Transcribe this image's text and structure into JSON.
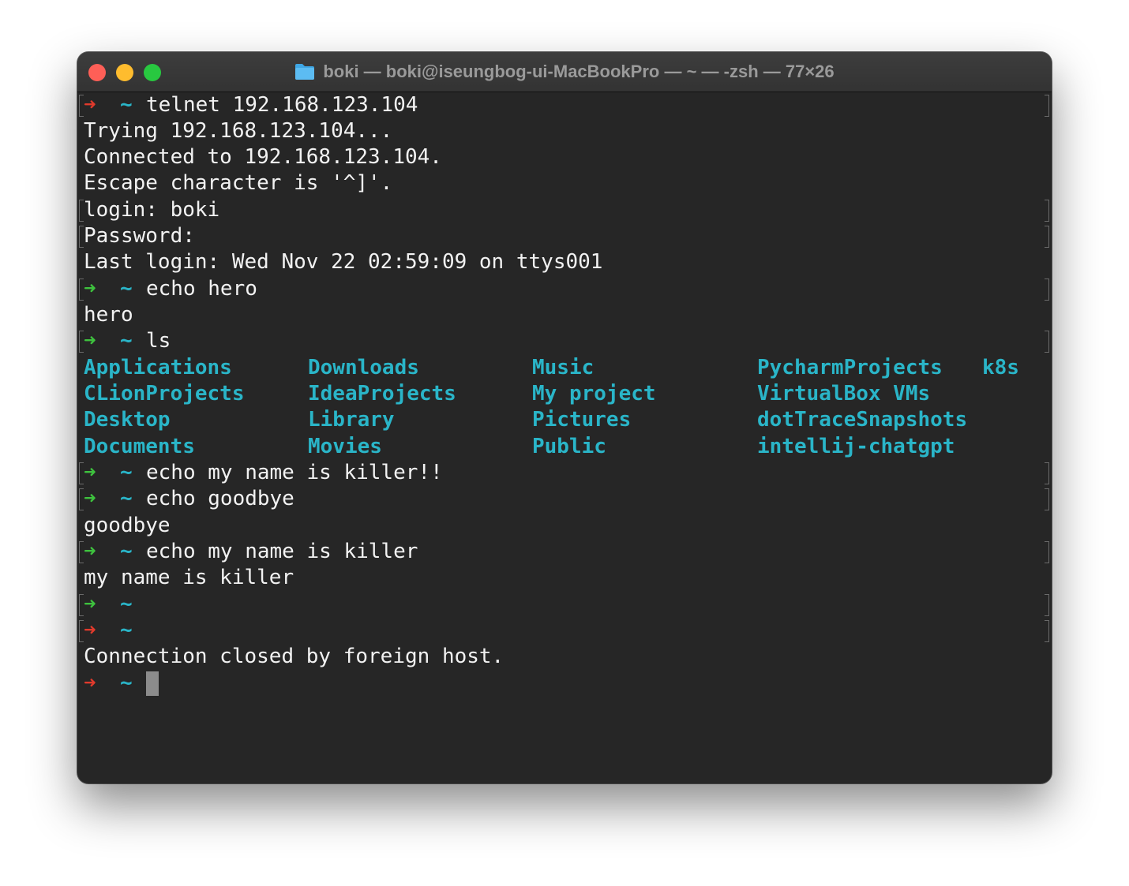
{
  "window": {
    "title": "boki — boki@iseungbog-ui-MacBookPro — ~ — -zsh — 77×26",
    "folder_icon": "folder-icon"
  },
  "prompt": {
    "tilde": "~",
    "arrow": "➜"
  },
  "terminal": {
    "cmd_telnet": "telnet 192.168.123.104",
    "out_trying": "Trying 192.168.123.104...",
    "out_connected": "Connected to 192.168.123.104.",
    "out_escape": "Escape character is '^]'.",
    "out_login": "login: boki",
    "out_password": "Password:",
    "out_last_login": "Last login: Wed Nov 22 02:59:09 on ttys001",
    "cmd_echo_hero": "echo hero",
    "out_hero": "hero",
    "cmd_ls": "ls",
    "ls_dirs": [
      "Applications",
      "Downloads",
      "Music",
      "PycharmProjects",
      "k8s",
      "CLionProjects",
      "IdeaProjects",
      "My project",
      "VirtualBox VMs",
      "Desktop",
      "Library",
      "Pictures",
      "dotTraceSnapshots",
      "Documents",
      "Movies",
      "Public",
      "intellij-chatgpt"
    ],
    "cmd_echo_killer_bang": "echo my name is killer!!",
    "cmd_echo_goodbye": "echo goodbye",
    "out_goodbye": "goodbye",
    "cmd_echo_killer": "echo my name is killer",
    "out_killer": "my name is killer",
    "out_closed": "Connection closed by foreign host."
  },
  "colors": {
    "background": "#262626",
    "text": "#f2f2f2",
    "directory": "#2ab5c8",
    "prompt_ok": "#3ec23e",
    "prompt_err": "#e03a2c"
  }
}
